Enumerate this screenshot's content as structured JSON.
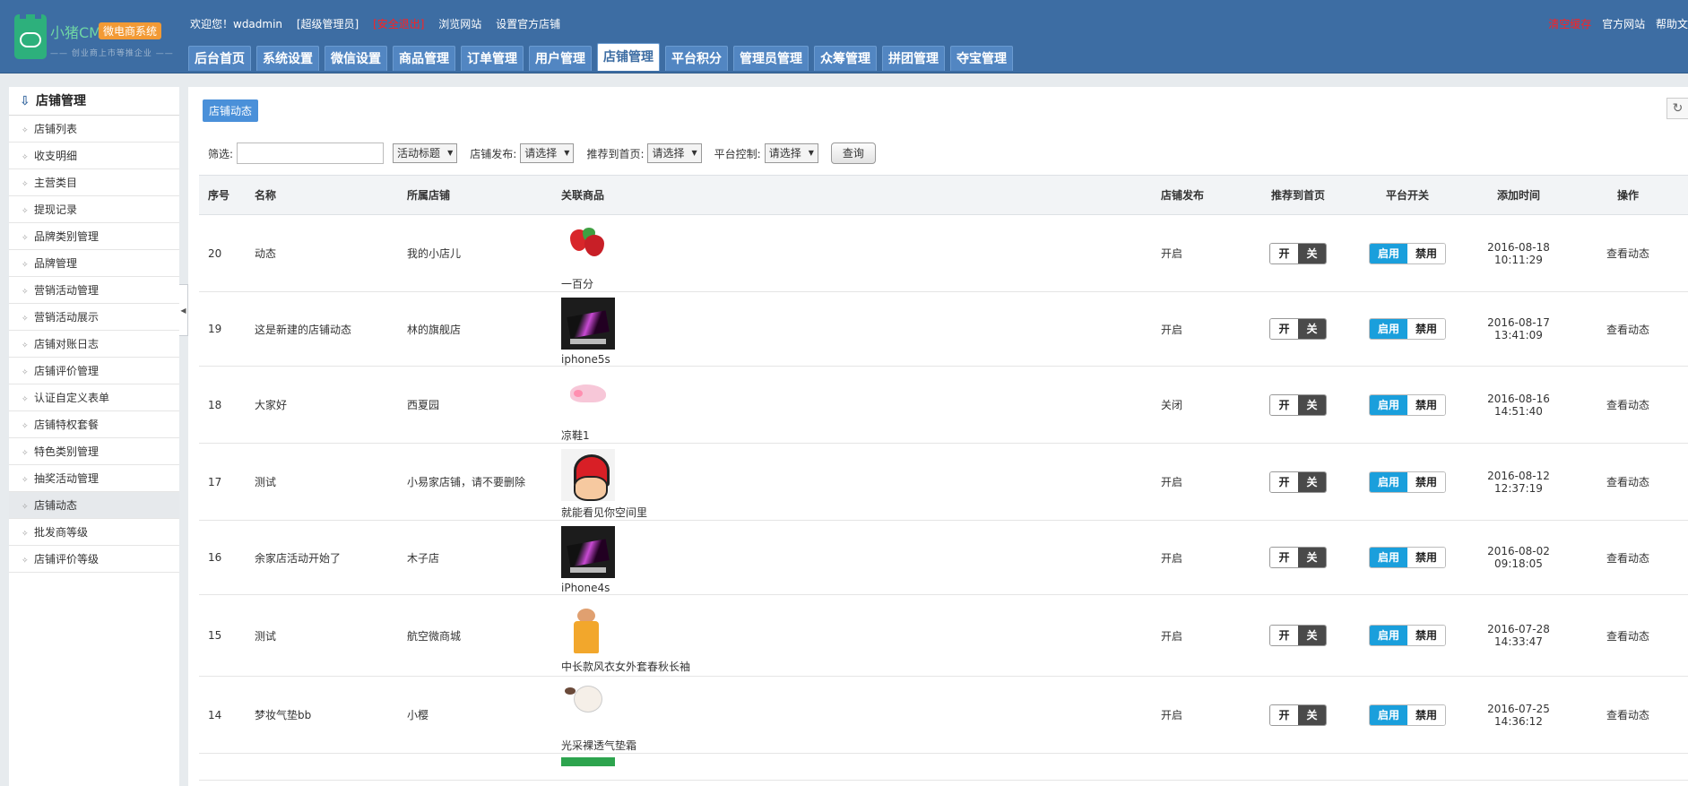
{
  "header": {
    "logo_brand": "小猪CMS",
    "logo_badge": "微电商系统",
    "logo_slogan": "—— 创业商上市等推企业 ——",
    "welcome": "欢迎您！wdadmin",
    "role": "[超级管理员]",
    "logout": "[安全退出]",
    "browse_site": "浏览网站",
    "set_shop": "设置官方店铺",
    "clear_cache": "清空缓存",
    "official_site": "官方网站",
    "help": "帮助文"
  },
  "nav": {
    "tabs": [
      "后台首页",
      "系统设置",
      "微信设置",
      "商品管理",
      "订单管理",
      "用户管理",
      "店铺管理",
      "平台积分",
      "管理员管理",
      "众筹管理",
      "拼团管理",
      "夺宝管理"
    ],
    "active_index": 6
  },
  "sidebar": {
    "title": "店铺管理",
    "items": [
      "店铺列表",
      "收支明细",
      "主营类目",
      "提现记录",
      "品牌类别管理",
      "品牌管理",
      "营销活动管理",
      "营销活动展示",
      "店铺对账日志",
      "店铺评价管理",
      "认证自定义表单",
      "店铺特权套餐",
      "特色类别管理",
      "抽奖活动管理",
      "店铺动态",
      "批发商等级",
      "店铺评价等级"
    ],
    "active_index": 14
  },
  "breadcrumb": "店铺动态",
  "filter": {
    "label": "筛选:",
    "field_select": "活动标题",
    "publish_label": "店铺发布:",
    "publish_select": "请选择",
    "recommend_label": "推荐到首页:",
    "recommend_select": "请选择",
    "platform_label": "平台控制:",
    "platform_select": "请选择",
    "query_button": "查询"
  },
  "table": {
    "headers": [
      "序号",
      "名称",
      "所属店铺",
      "关联商品",
      "店铺发布",
      "推荐到首页",
      "平台开关",
      "添加时间",
      "操作"
    ],
    "switch_on": "开",
    "switch_off": "关",
    "enable": "启用",
    "disable": "禁用",
    "action": "查看动态",
    "rows": [
      {
        "id": "20",
        "name": "动态",
        "shop": "我的小店儿",
        "product": "一百分",
        "pic": "strawberry",
        "publish": "开启",
        "date": "2016-08-18",
        "time": "10:11:29"
      },
      {
        "id": "19",
        "name": "这是新建的店铺动态",
        "shop": "林的旗舰店",
        "product": "iphone5s",
        "pic": "phone",
        "publish": "开启",
        "date": "2016-08-17",
        "time": "13:41:09"
      },
      {
        "id": "18",
        "name": "大家好",
        "shop": "西夏园",
        "product": "凉鞋1",
        "pic": "sandal",
        "publish": "关闭",
        "date": "2016-08-16",
        "time": "14:51:40"
      },
      {
        "id": "17",
        "name": "测试",
        "shop": "小易家店铺，请不要删除",
        "product": "就能看见你空间里",
        "pic": "avatar",
        "publish": "开启",
        "date": "2016-08-12",
        "time": "12:37:19"
      },
      {
        "id": "16",
        "name": "余家店活动开始了",
        "shop": "木子店",
        "product": "iPhone4s",
        "pic": "phone",
        "publish": "开启",
        "date": "2016-08-02",
        "time": "09:18:05"
      },
      {
        "id": "15",
        "name": "测试",
        "shop": "航空微商城",
        "product": "中长款风衣女外套春秋长袖",
        "pic": "coat",
        "publish": "开启",
        "date": "2016-07-28",
        "time": "14:33:47"
      },
      {
        "id": "14",
        "name": "梦妆气垫bb",
        "shop": "小樱",
        "product": "光采裸透气垫霜",
        "pic": "cushion",
        "publish": "开启",
        "date": "2016-07-25",
        "time": "14:36:12"
      }
    ]
  },
  "colors": {
    "header_bg": "#3d6da3",
    "status_on": "#1e9e1e",
    "status_off": "#ff2b2b",
    "enable_btn": "#1a9fdc"
  }
}
